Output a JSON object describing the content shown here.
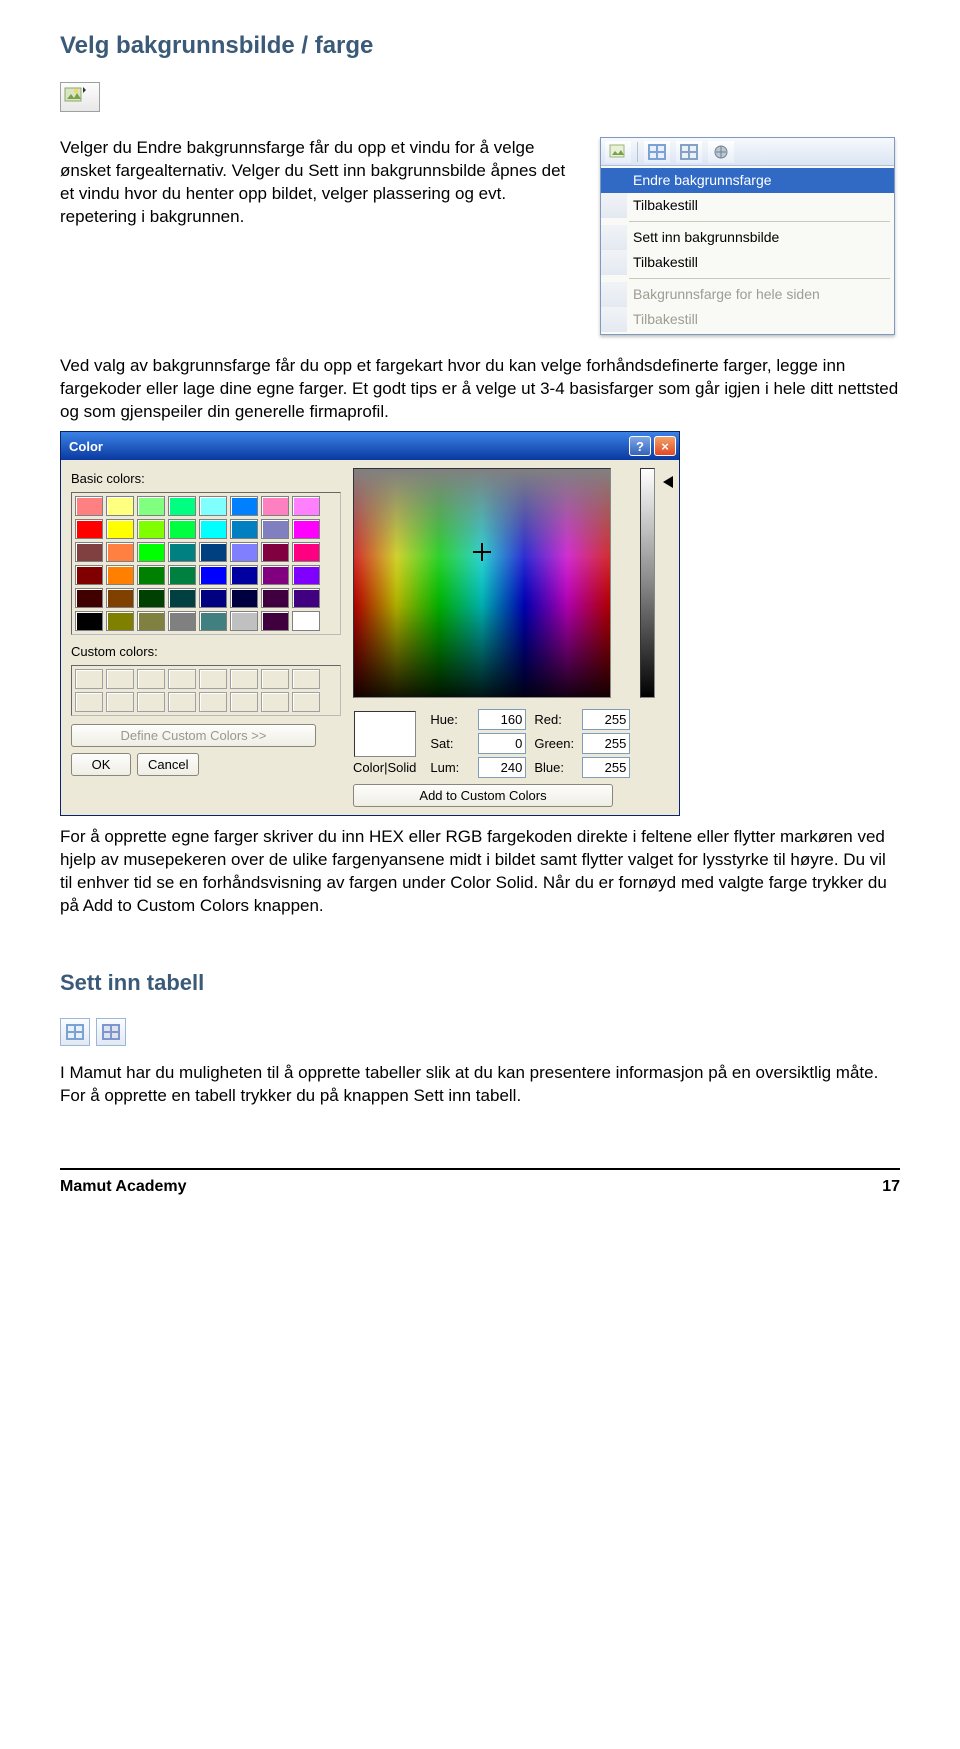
{
  "title": "Velg bakgrunnsbilde / farge",
  "paragraph1": "Velger du Endre bakgrunnsfarge får du opp et vindu for å velge ønsket fargealternativ. Velger du Sett inn bakgrunnsbilde åpnes det et vindu hvor du henter opp bildet, velger plassering og evt. repetering i bakgrunnen.",
  "context_menu": {
    "items": [
      {
        "label": "Endre bakgrunnsfarge",
        "selected": true
      },
      {
        "label": "Tilbakestill"
      },
      {
        "label": "Sett inn bakgrunnsbilde"
      },
      {
        "label": "Tilbakestill"
      },
      {
        "label": "Bakgrunnsfarge for hele siden",
        "disabled": true
      },
      {
        "label": "Tilbakestill",
        "disabled": true
      }
    ]
  },
  "paragraph2": "Ved valg av bakgrunnsfarge får du opp et fargekart hvor du kan velge forhåndsdefinerte farger, legge inn fargekoder eller lage dine egne farger. Et godt tips er å velge ut 3-4 basisfarger som går igjen i hele ditt nettsted og som gjenspeiler din generelle firmaprofil.",
  "dialog": {
    "title": "Color",
    "labels": {
      "basic": "Basic colors:",
      "custom": "Custom colors:",
      "define": "Define Custom Colors >>",
      "ok": "OK",
      "cancel": "Cancel",
      "color_solid": "Color|Solid",
      "add": "Add to Custom Colors",
      "hue": "Hue:",
      "sat": "Sat:",
      "lum": "Lum:",
      "red": "Red:",
      "green": "Green:",
      "blue": "Blue:"
    },
    "values": {
      "hue": "160",
      "sat": "0",
      "lum": "240",
      "red": "255",
      "green": "255",
      "blue": "255"
    },
    "basic_colors": [
      "#ff8080",
      "#ffff80",
      "#80ff80",
      "#00ff80",
      "#80ffff",
      "#0080ff",
      "#ff80c0",
      "#ff80ff",
      "#ff0000",
      "#ffff00",
      "#80ff00",
      "#00ff40",
      "#00ffff",
      "#0080c0",
      "#8080c0",
      "#ff00ff",
      "#804040",
      "#ff8040",
      "#00ff00",
      "#008080",
      "#004080",
      "#8080ff",
      "#800040",
      "#ff0080",
      "#800000",
      "#ff8000",
      "#008000",
      "#008040",
      "#0000ff",
      "#0000a0",
      "#800080",
      "#8000ff",
      "#400000",
      "#804000",
      "#004000",
      "#004040",
      "#000080",
      "#000040",
      "#400040",
      "#400080",
      "#000000",
      "#808000",
      "#808040",
      "#808080",
      "#408080",
      "#c0c0c0",
      "#400040",
      "#ffffff"
    ]
  },
  "paragraph3": "For å opprette egne farger skriver du inn HEX eller RGB fargekoden direkte i feltene eller flytter markøren ved hjelp av musepekeren over de ulike fargenyansene midt i bildet samt flytter valget for lysstyrke til høyre. Du vil til enhver tid se en forhåndsvisning av fargen under Color Solid. Når du er fornøyd med valgte farge trykker du på Add to Custom Colors knappen.",
  "sub_title": "Sett inn tabell",
  "paragraph4": "I Mamut har du muligheten til å opprette tabeller slik at du kan presentere informasjon på en oversiktlig måte. For å opprette en tabell trykker du på knappen Sett inn tabell.",
  "footer": {
    "left": "Mamut Academy",
    "right": "17"
  }
}
